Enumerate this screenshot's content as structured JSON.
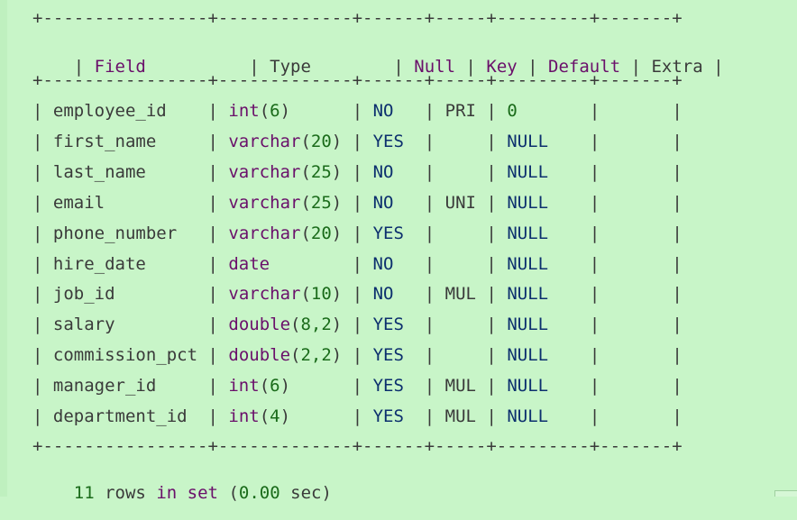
{
  "table": {
    "border": "+----------------+-------------+------+-----+---------+-------+",
    "headers": [
      "Field",
      "Type",
      "Null",
      "Key",
      "Default",
      "Extra"
    ],
    "rows": [
      {
        "field": "employee_id",
        "type_name": "int",
        "type_args": "6",
        "null": "NO",
        "key": "PRI",
        "default": "0",
        "extra": ""
      },
      {
        "field": "first_name",
        "type_name": "varchar",
        "type_args": "20",
        "null": "YES",
        "key": "",
        "default": "NULL",
        "extra": ""
      },
      {
        "field": "last_name",
        "type_name": "varchar",
        "type_args": "25",
        "null": "NO",
        "key": "",
        "default": "NULL",
        "extra": ""
      },
      {
        "field": "email",
        "type_name": "varchar",
        "type_args": "25",
        "null": "NO",
        "key": "UNI",
        "default": "NULL",
        "extra": ""
      },
      {
        "field": "phone_number",
        "type_name": "varchar",
        "type_args": "20",
        "null": "YES",
        "key": "",
        "default": "NULL",
        "extra": ""
      },
      {
        "field": "hire_date",
        "type_name": "date",
        "type_args": "",
        "null": "NO",
        "key": "",
        "default": "NULL",
        "extra": ""
      },
      {
        "field": "job_id",
        "type_name": "varchar",
        "type_args": "10",
        "null": "NO",
        "key": "MUL",
        "default": "NULL",
        "extra": ""
      },
      {
        "field": "salary",
        "type_name": "double",
        "type_args": "8,2",
        "null": "YES",
        "key": "",
        "default": "NULL",
        "extra": ""
      },
      {
        "field": "commission_pct",
        "type_name": "double",
        "type_args": "2,2",
        "null": "YES",
        "key": "",
        "default": "NULL",
        "extra": ""
      },
      {
        "field": "manager_id",
        "type_name": "int",
        "type_args": "6",
        "null": "YES",
        "key": "MUL",
        "default": "NULL",
        "extra": ""
      },
      {
        "field": "department_id",
        "type_name": "int",
        "type_args": "4",
        "null": "YES",
        "key": "MUL",
        "default": "NULL",
        "extra": ""
      }
    ]
  },
  "footer": {
    "count": "11",
    "word_rows": "rows",
    "word_in": "in",
    "word_set": "set",
    "timing": "0.00",
    "unit": "sec"
  },
  "colors": {
    "background": "#c8f5c8",
    "keyword": "#6a0f6a",
    "number": "#1a6b1a",
    "literal": "#0c2f6e",
    "plain": "#3a3a3a"
  }
}
